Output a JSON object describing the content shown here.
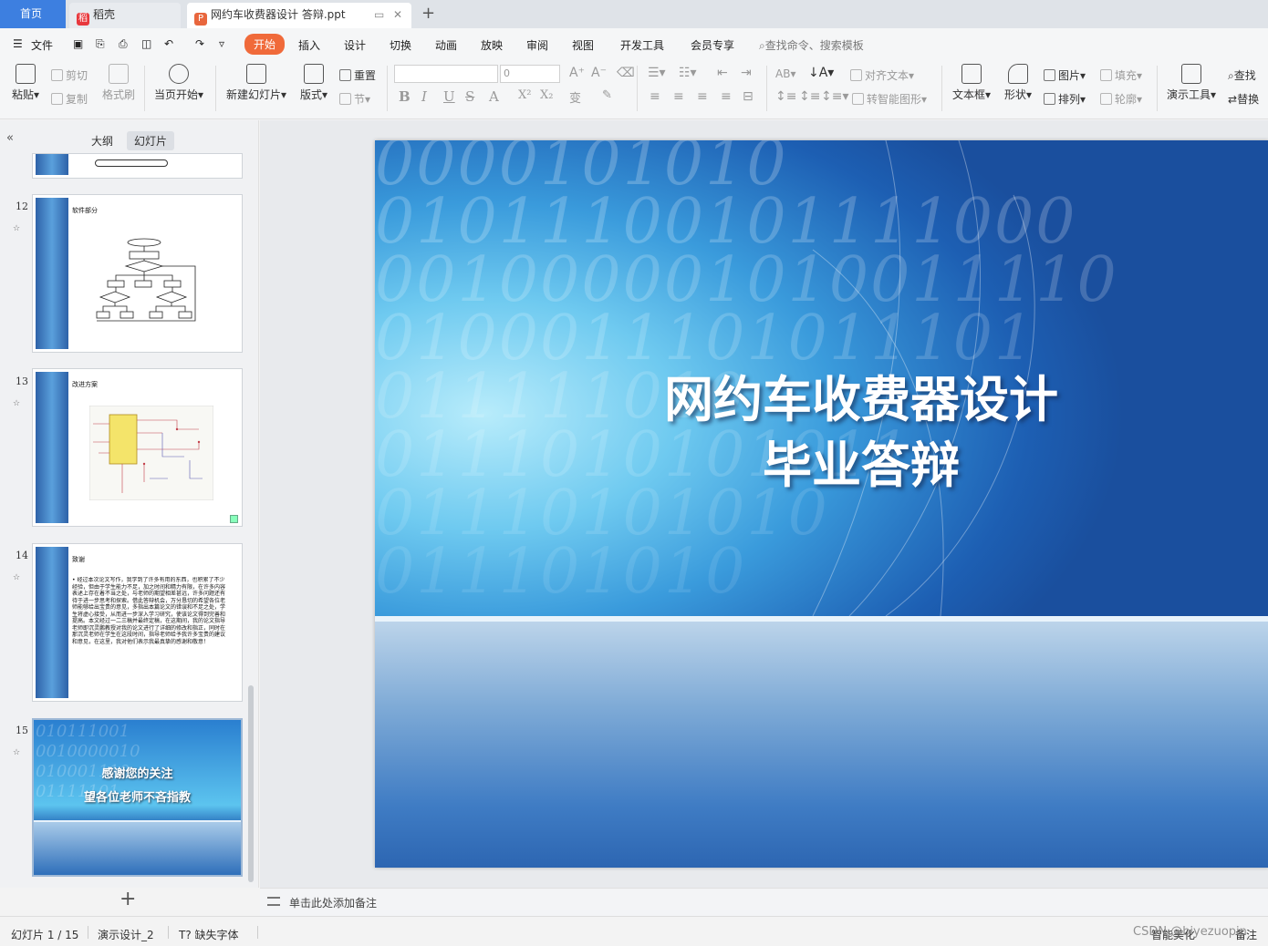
{
  "tabs": {
    "home": "首页",
    "daoke": "稻壳",
    "doc": "网约车收费器设计 答辩.ppt"
  },
  "menu": {
    "file": "文件",
    "items": [
      "开始",
      "插入",
      "设计",
      "切换",
      "动画",
      "放映",
      "审阅",
      "视图",
      "开发工具",
      "会员专享"
    ],
    "search": "查找命令、搜索模板"
  },
  "ribbon": {
    "paste": "粘贴",
    "cut": "剪切",
    "copy": "复制",
    "format_painter": "格式刷",
    "play_current": "当页开始",
    "new_slide": "新建幻灯片",
    "layout": "版式",
    "reset": "重置",
    "section": "节",
    "font_size": "0",
    "align_text": "对齐文本",
    "smart_shape": "转智能图形",
    "textbox": "文本框",
    "shape": "形状",
    "picture": "图片",
    "arrange": "排列",
    "fill": "填充",
    "outline": "轮廓",
    "present_tools": "演示工具",
    "find": "查找",
    "replace": "替换"
  },
  "panel": {
    "tab_outline": "大纲",
    "tab_slides": "幻灯片",
    "slides": [
      {
        "num": "12",
        "title": "软件部分"
      },
      {
        "num": "13",
        "title": "改进方案"
      },
      {
        "num": "14",
        "title": "致谢",
        "body": "经过本次论文写作，我学到了许多有用的东西，也积累了不少经验，但由于学生能力不足，加之时间和精力有限，在许多内容表述上存在着不当之处，与老师的期望相差甚远，许多问题还有待于进一步思考和探索。借此答辩机会，万分恳切的希望各位老师能够给出宝贵的意见，多指出本篇论文的错误和不足之处，学生将虚心接受，从而进一步深入学习研究，使该论文得到完善和提高。本文经过一二三稿并最终定稿，在这期间，我的论文指导老师即沉灵鹏教授对我的论文进行了详细的修改和指正，同时在那沉灵老师在学生在这段时间，指导老师给予我许多宝贵的建议和意见，在这里，我对他们表示我最真挚的感谢和敬意！"
      },
      {
        "num": "15",
        "line1": "感谢您的关注",
        "line2": "望各位老师不吝指教"
      }
    ]
  },
  "slide": {
    "title_line1": "网约车收费器设计",
    "title_line2": "毕业答辩",
    "binary_rows": [
      "0000101010",
      "01011100101111000",
      "001000001010011110",
      "0100011101011101",
      "011111010",
      "0111010101011",
      "01110101010",
      "011101010"
    ]
  },
  "notes": {
    "placeholder": "单击此处添加备注"
  },
  "status": {
    "slide_pos": "幻灯片 1 / 15",
    "theme": "演示设计_2",
    "missing_font": "缺失字体",
    "smart_beauty": "智能美化",
    "remark": "备注",
    "watermark": "CSDN @biyezuopin"
  },
  "colors": {
    "accent_orange": "#f06a3a",
    "home_tab_blue": "#3d7fe0"
  }
}
